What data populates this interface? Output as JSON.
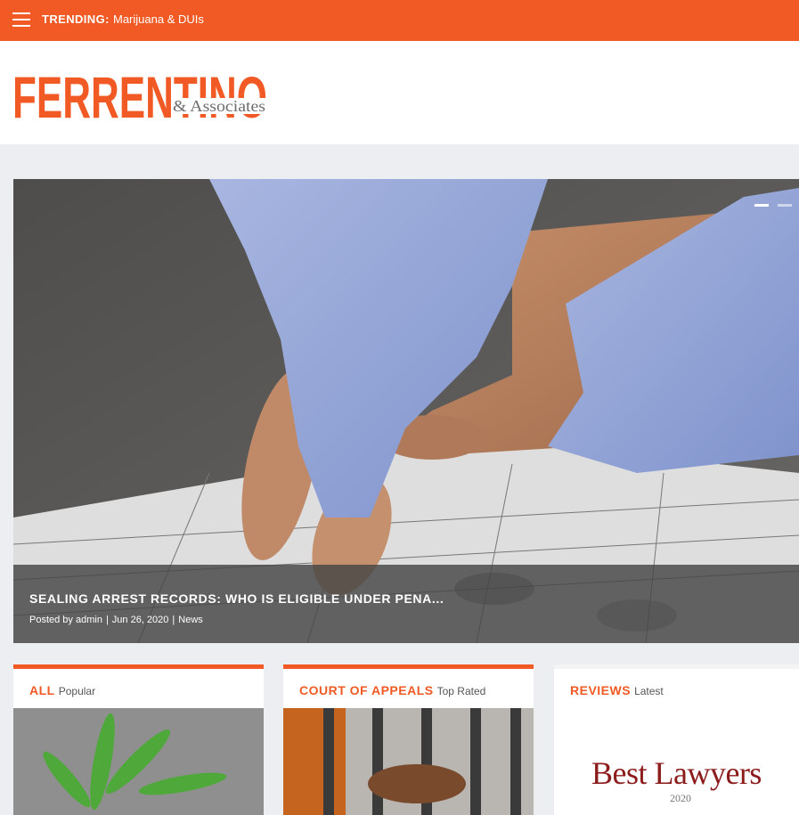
{
  "topbar": {
    "trending_label": "TRENDING:",
    "trending_item": "Marijuana & DUIs"
  },
  "logo": {
    "main": "FERRENTINO",
    "sub": "& Associates"
  },
  "hero": {
    "title": "SEALING ARREST RECORDS: WHO IS ELIGIBLE UNDER PENA...",
    "posted_by": "Posted by admin",
    "date": "Jun 26, 2020",
    "category": "News",
    "separator": "|"
  },
  "cards": [
    {
      "title": "ALL",
      "sub": "Popular"
    },
    {
      "title": "COURT OF APPEALS",
      "sub": "Top Rated"
    },
    {
      "title": "REVIEWS",
      "sub": "Latest"
    }
  ],
  "reviews_image": {
    "brand": "Best Lawyers",
    "year": "2020"
  },
  "colors": {
    "accent": "#f15a24",
    "logo_gray": "#6d6d6d",
    "caption_bg": "#464646"
  },
  "icons": [
    "hamburger-menu-icon"
  ]
}
